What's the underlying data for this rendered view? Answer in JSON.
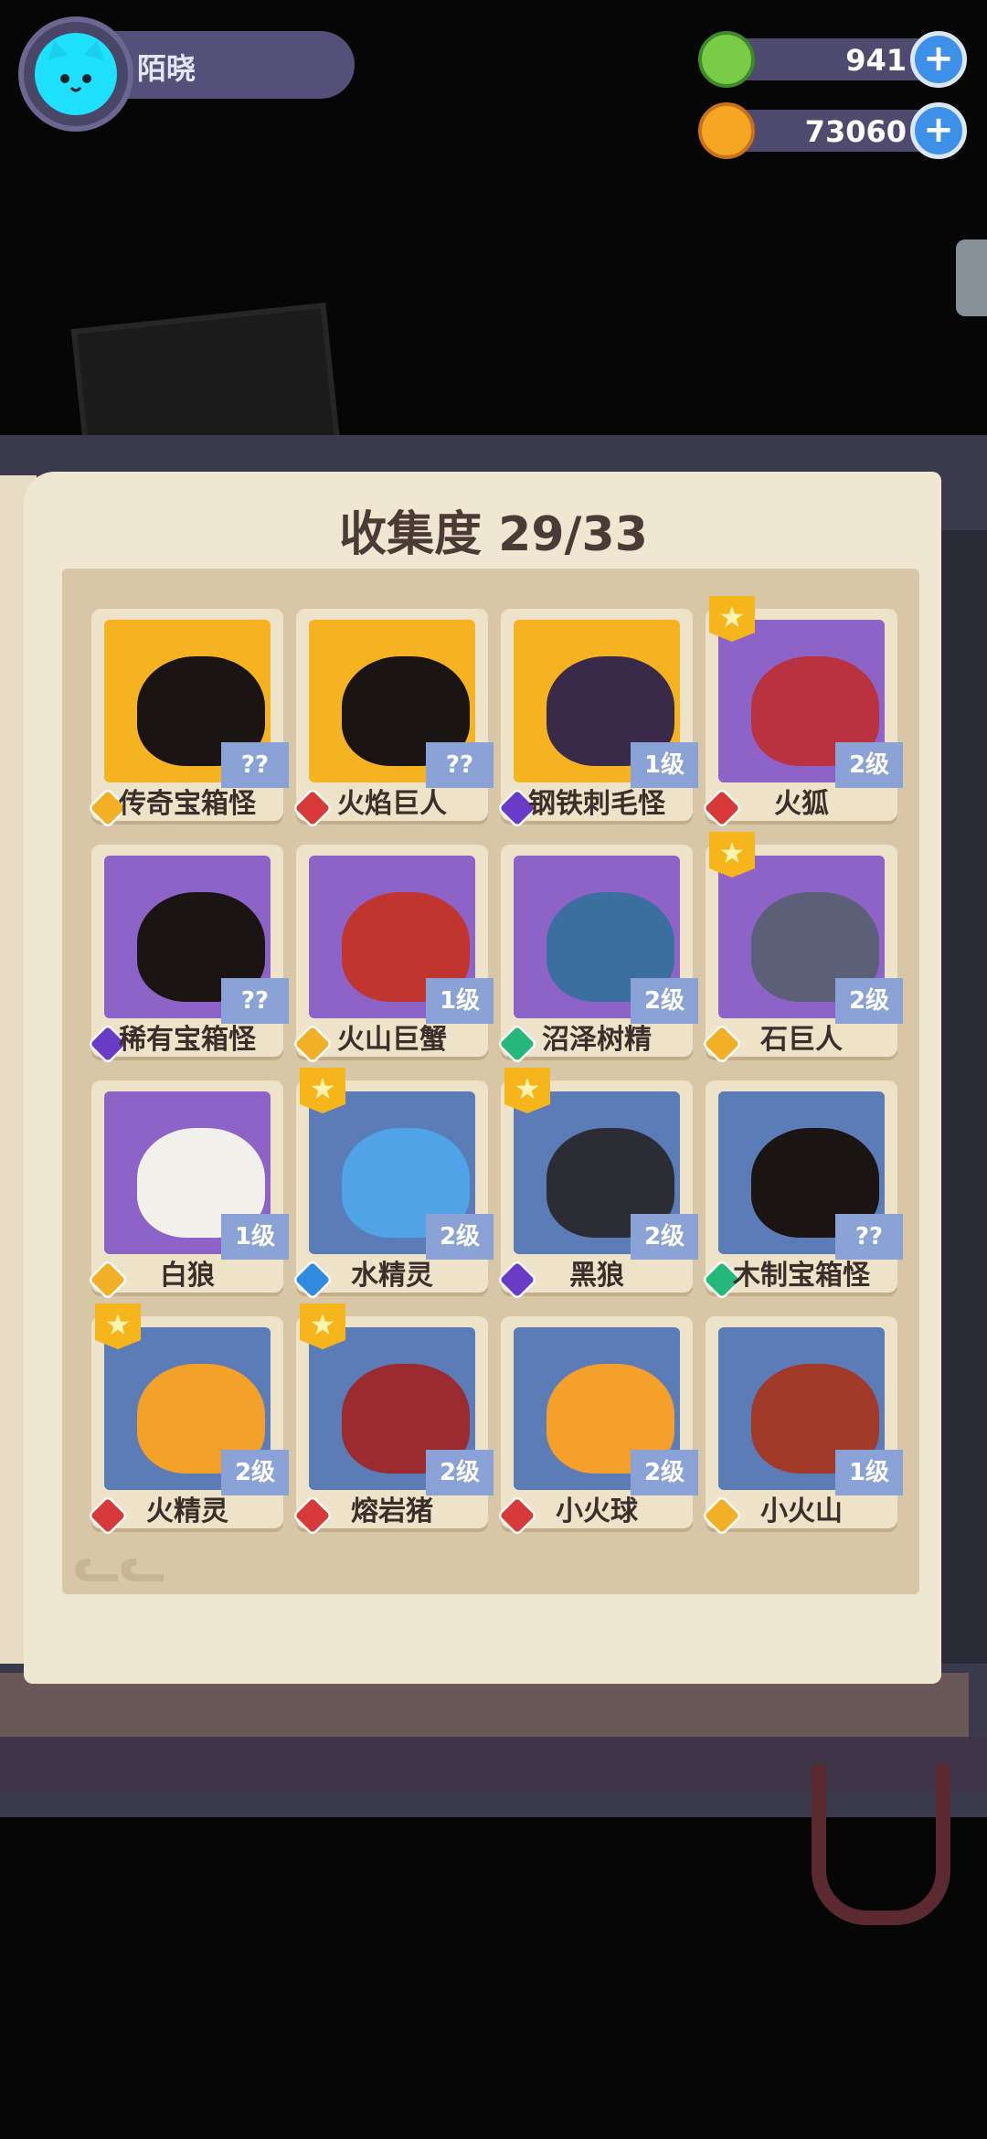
{
  "player": {
    "name": "陌晓",
    "avatar_icon": "cat-face-icon"
  },
  "currencies": [
    {
      "name": "green-gem",
      "value": "941",
      "icon": "green-gem-icon",
      "color": "#7acb45"
    },
    {
      "name": "gold-planet",
      "value": "73060",
      "icon": "gold-planet-icon",
      "color": "#f5a623"
    }
  ],
  "book": {
    "title": "收集度 29/33"
  },
  "cards": [
    {
      "name": "传奇宝箱怪",
      "level": "??",
      "bg": "gold",
      "rarity": "gold",
      "star": false,
      "silhouette": true
    },
    {
      "name": "火焰巨人",
      "level": "??",
      "bg": "gold",
      "rarity": "red",
      "star": false,
      "silhouette": true
    },
    {
      "name": "钢铁刺毛怪",
      "level": "1级",
      "bg": "gold",
      "rarity": "purple",
      "star": false,
      "silhouette": false
    },
    {
      "name": "火狐",
      "level": "2级",
      "bg": "purple",
      "rarity": "red",
      "star": true,
      "silhouette": false
    },
    {
      "name": "稀有宝箱怪",
      "level": "??",
      "bg": "purple",
      "rarity": "purple",
      "star": false,
      "silhouette": true
    },
    {
      "name": "火山巨蟹",
      "level": "1级",
      "bg": "purple",
      "rarity": "gold",
      "star": false,
      "silhouette": false
    },
    {
      "name": "沼泽树精",
      "level": "2级",
      "bg": "purple",
      "rarity": "green",
      "star": false,
      "silhouette": false
    },
    {
      "name": "石巨人",
      "level": "2级",
      "bg": "purple",
      "rarity": "gold",
      "star": true,
      "silhouette": false
    },
    {
      "name": "白狼",
      "level": "1级",
      "bg": "purple",
      "rarity": "gold",
      "star": false,
      "silhouette": false
    },
    {
      "name": "水精灵",
      "level": "2级",
      "bg": "blue",
      "rarity": "blue",
      "star": true,
      "silhouette": false
    },
    {
      "name": "黑狼",
      "level": "2级",
      "bg": "blue",
      "rarity": "purple",
      "star": true,
      "silhouette": false
    },
    {
      "name": "木制宝箱怪",
      "level": "??",
      "bg": "blue",
      "rarity": "green",
      "star": false,
      "silhouette": true
    },
    {
      "name": "火精灵",
      "level": "2级",
      "bg": "blue",
      "rarity": "red",
      "star": true,
      "silhouette": false
    },
    {
      "name": "熔岩猪",
      "level": "2级",
      "bg": "blue",
      "rarity": "red",
      "star": true,
      "silhouette": false
    },
    {
      "name": "小火球",
      "level": "2级",
      "bg": "blue",
      "rarity": "red",
      "star": false,
      "silhouette": false
    },
    {
      "name": "小火山",
      "level": "1级",
      "bg": "blue",
      "rarity": "gold",
      "star": false,
      "silhouette": false
    }
  ],
  "monster_colors": [
    "#1a1412",
    "#1a1412",
    "#3a2a4a",
    "#b8323f",
    "#1a1412",
    "#c0352e",
    "#3b6fa0",
    "#5b5f78",
    "#f2f0ea",
    "#4fa3e6",
    "#2c2c34",
    "#1a1412",
    "#f3a128",
    "#9b2b2e",
    "#f5a02a",
    "#a23a2a"
  ]
}
